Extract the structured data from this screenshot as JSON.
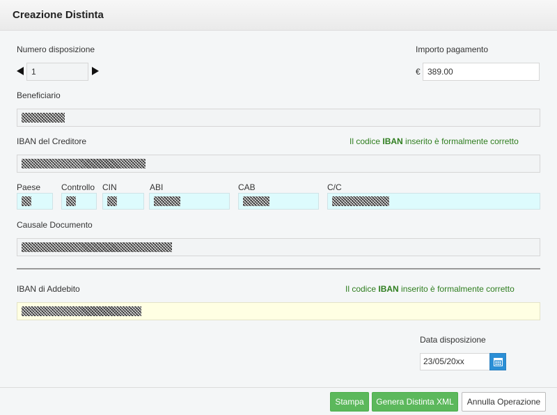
{
  "title": "Creazione Distinta",
  "numero": {
    "label": "Numero disposizione",
    "value": "1"
  },
  "importo": {
    "label": "Importo pagamento",
    "currency": "€",
    "value": "389.00"
  },
  "beneficiario": {
    "label": "Beneficiario"
  },
  "iban_creditore": {
    "label": "IBAN del Creditore",
    "status_pre": "Il codice ",
    "status_bold": "IBAN",
    "status_post": " inserito è formalmente corretto"
  },
  "iban_parts": {
    "paese": "Paese",
    "controllo": "Controllo",
    "cin": "CIN",
    "abi": "ABI",
    "cab": "CAB",
    "cc": "C/C"
  },
  "causale": {
    "label": "Causale Documento"
  },
  "iban_addebito": {
    "label": "IBAN di Addebito",
    "status_pre": "Il codice ",
    "status_bold": "IBAN",
    "status_post": " inserito è formalmente corretto"
  },
  "data": {
    "label": "Data disposizione",
    "value": "23/05/20xx"
  },
  "buttons": {
    "stampa": "Stampa",
    "genera": "Genera Distinta XML",
    "annulla": "Annulla Operazione"
  },
  "colors": {
    "success_text": "#2e7d1e",
    "primary_button": "#5cb85c",
    "calendar_button": "#2b8fd6",
    "cyan_field": "#ddfbfd",
    "yellow_field": "#ffffe3"
  },
  "icons": {
    "prev": "triangle-left",
    "next": "triangle-right",
    "calendar": "calendar-icon"
  }
}
